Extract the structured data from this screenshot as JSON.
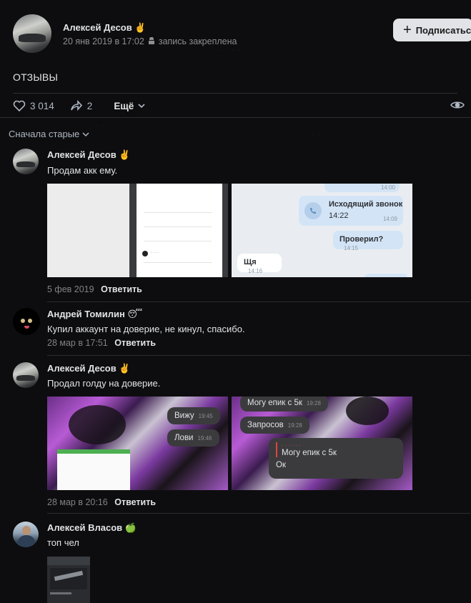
{
  "post": {
    "author": "Алексей Десов",
    "author_emoji": "✌️",
    "date": "20 янв 2019 в 17:02",
    "pinned": "запись закреплена",
    "subscribe": "Подписаться",
    "title": "ОТЗЫВЫ",
    "likes": "3 014",
    "shares": "2",
    "more": "Ещё"
  },
  "sort_label": "Сначала старые",
  "comments": [
    {
      "author": "Алексей Десов",
      "emoji": "✌️",
      "text": "Продам акк ему.",
      "date": "5 фев 2019",
      "reply": "Ответить",
      "chat": {
        "b1": "Исходящий звонок",
        "b1_time": "14:22",
        "b1_stamp": "14:09",
        "b2": "Проверил?",
        "b2_time": "14:15",
        "b3": "Щя",
        "b3_time": "14:16",
        "top_time": "14:00"
      }
    },
    {
      "author": "Андрей Томилин",
      "emoji": "😴",
      "text": "Купил аккаунт на доверие, не кинул, спасибо.",
      "date": "28 мар в 17:51",
      "reply": "Ответить"
    },
    {
      "author": "Алексей Десов",
      "emoji": "✌️",
      "text": "Продал голду на доверие.",
      "date": "28 мар в 20:16",
      "reply": "Ответить",
      "left_msgs": [
        "Вижу",
        "Лови"
      ],
      "right_msgs": {
        "m1": "Могу епик с 5к",
        "m2": "Запросов",
        "quote": "Могу епик с 5к",
        "m3": "Ок"
      }
    },
    {
      "author": "Алексей Власов",
      "emoji": "🍏",
      "text": "топ чел"
    }
  ]
}
